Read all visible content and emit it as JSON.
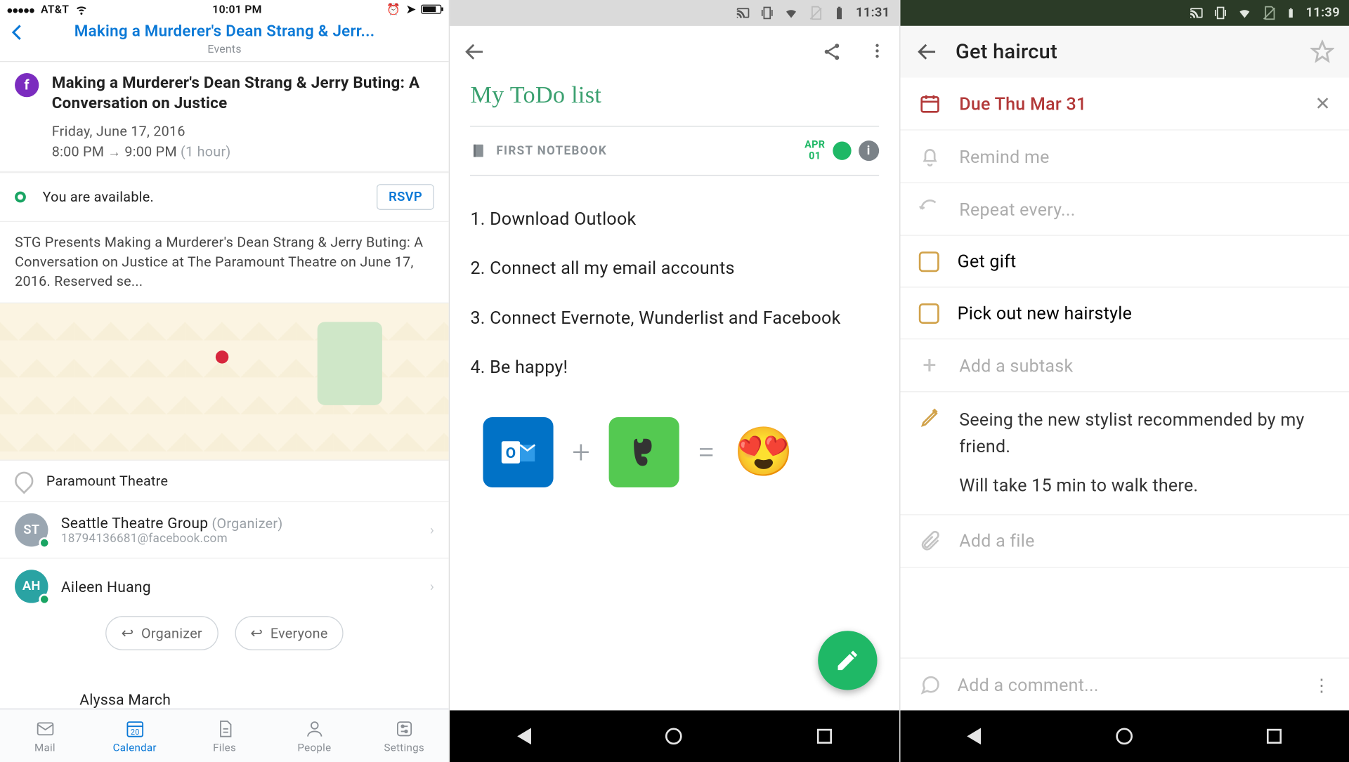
{
  "phone1": {
    "status": {
      "carrier": "AT&T",
      "time": "10:01 PM"
    },
    "header": {
      "title": "Making a Murderer's Dean Strang & Jerr...",
      "subtitle": "Events"
    },
    "event": {
      "avatar_letter": "f",
      "title": "Making a Murderer's Dean Strang & Jerry Buting: A Conversation on Justice",
      "date": "Friday, June 17, 2016",
      "time_start": "8:00 PM",
      "time_end": "9:00 PM",
      "duration": "(1 hour)"
    },
    "availability": "You are available.",
    "rsvp": "RSVP",
    "description": "STG Presents Making a Murderer's Dean Strang & Jerry Buting: A Conversation on Justice at The Paramount Theatre on June 17, 2016. Reserved se...",
    "location": "Paramount Theatre",
    "attendees": [
      {
        "initials": "ST",
        "color": "#9aa6b1",
        "name": "Seattle Theatre Group",
        "role": "(Organizer)",
        "email": "18794136681@facebook.com"
      },
      {
        "initials": "AH",
        "color": "#2aa3a3",
        "name": "Aileen Huang",
        "role": "",
        "email": ""
      }
    ],
    "third_attendee": "Alyssa March",
    "reply": {
      "organizer": "Organizer",
      "everyone": "Everyone"
    },
    "tabs": {
      "mail": "Mail",
      "calendar": "Calendar",
      "cal_num": "20",
      "files": "Files",
      "people": "People",
      "settings": "Settings"
    }
  },
  "phone2": {
    "status_time": "11:31",
    "title": "My ToDo list",
    "notebook": "FIRST NOTEBOOK",
    "date_month": "APR",
    "date_day": "01",
    "items": [
      "1. Download Outlook",
      "2. Connect all my email accounts",
      "3. Connect Evernote, Wunderlist and Facebook",
      "4. Be happy!"
    ]
  },
  "phone3": {
    "status_time": "11:39",
    "title": "Get haircut",
    "due": "Due Thu Mar 31",
    "remind": "Remind me",
    "repeat": "Repeat every...",
    "subtasks": [
      "Get gift",
      "Pick out new hairstyle"
    ],
    "add_subtask": "Add a subtask",
    "note_line1": "Seeing the new stylist recommended by my friend.",
    "note_line2": "Will take 15 min to walk there.",
    "add_file": "Add a file",
    "add_comment": "Add a comment..."
  }
}
